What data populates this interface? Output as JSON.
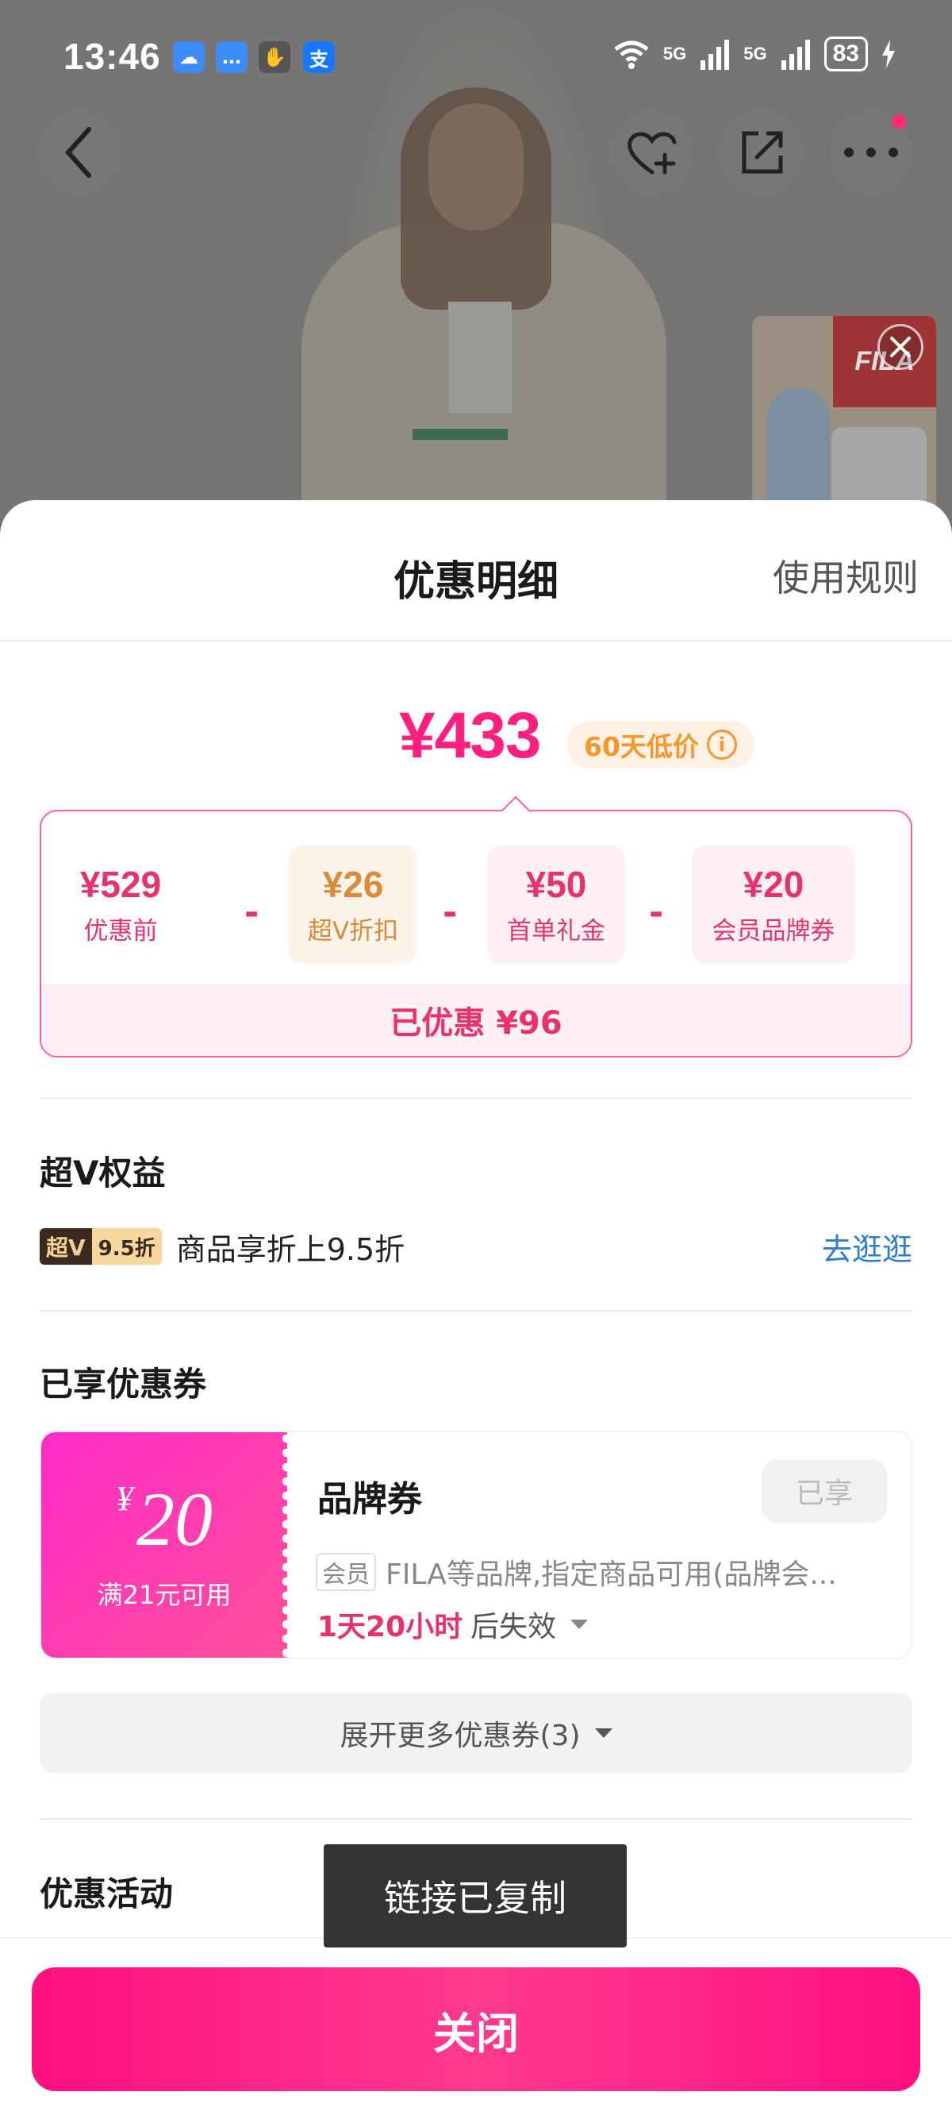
{
  "status_bar": {
    "time": "13:46",
    "apps": [
      {
        "icon": "cloud-app-icon",
        "glyph": "☁",
        "color": "#3d8cf6"
      },
      {
        "icon": "message-app-icon",
        "glyph": "…",
        "color": "#3d8cf6"
      },
      {
        "icon": "hand-app-icon",
        "glyph": "✋",
        "color": "#555555"
      },
      {
        "icon": "alipay-app-icon",
        "glyph": "支",
        "color": "#1677ff"
      }
    ],
    "signal_1": "5G",
    "signal_2": "5G",
    "battery": "83"
  },
  "promo_card": {
    "brand": "FILA"
  },
  "sheet": {
    "title": "优惠明细",
    "rules_link": "使用规则"
  },
  "price": {
    "final": "¥433",
    "low_badge": "60天低价",
    "info_glyph": "i"
  },
  "breakdown": {
    "items": [
      {
        "value": "¥529",
        "label": "优惠前"
      },
      {
        "value": "¥26",
        "label": "超V折扣"
      },
      {
        "value": "¥50",
        "label": "首单礼金"
      },
      {
        "value": "¥20",
        "label": "会员品牌券"
      }
    ],
    "minus": "-",
    "total": "已优惠 ¥96"
  },
  "superv": {
    "section_title": "超V权益",
    "badge_left": "超V",
    "badge_right": "9.5折",
    "text": "商品享折上9.5折",
    "link": "去逛逛"
  },
  "coupons": {
    "section_title": "已享优惠券",
    "item": {
      "yen": "¥",
      "amount": "20",
      "condition": "满21元可用",
      "title": "品牌券",
      "state": "已享",
      "member_tag": "会员",
      "description": "FILA等品牌,指定商品可用(品牌会...",
      "expire_time": "1天20小时",
      "expire_suffix": "后失效"
    },
    "expand_label": "展开更多优惠券(3)"
  },
  "activities": {
    "section_title": "优惠活动"
  },
  "toast": "链接已复制",
  "footer": {
    "close_label": "关闭"
  },
  "colors": {
    "accent": "#ff1f7f",
    "link": "#2f7dd1",
    "badge_orange": "#f7962a"
  }
}
